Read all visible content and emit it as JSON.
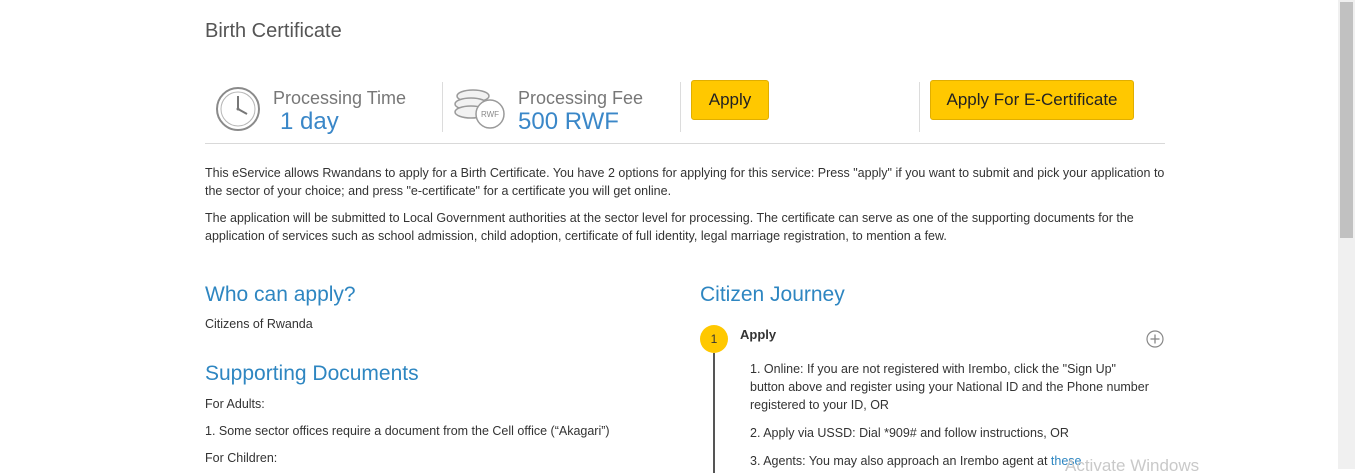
{
  "page": {
    "title": "Birth Certificate"
  },
  "info": {
    "processing_time_label": "Processing Time",
    "processing_time_value": "1 day",
    "processing_fee_label": "Processing Fee",
    "processing_fee_value": "500 RWF",
    "coin_text": "RWF",
    "apply_label": "Apply",
    "ecert_label": "Apply For E-Certificate"
  },
  "description": {
    "para1": "This eService allows Rwandans to apply for a Birth Certificate. You have 2 options for applying for this service: Press \"apply\" if you want to submit and pick your application to the sector of your choice; and press \"e-certificate\" for a certificate you will get online.",
    "para2": " The application will be submitted to Local Government authorities at the sector level for processing. The certificate can serve as one of the supporting documents for the application of services such as school admission, child adoption, certificate of full identity, legal marriage registration, to mention a few."
  },
  "who": {
    "heading": "Who can apply?",
    "text": "Citizens of Rwanda"
  },
  "docs": {
    "heading": "Supporting Documents",
    "adults_label": "For Adults:",
    "adults_item": "1. Some sector offices require a document from the Cell office (“Akagari”)",
    "children_label": "For Children:"
  },
  "journey": {
    "heading": "Citizen Journey",
    "step_number": "1",
    "step_title": "Apply",
    "item1": "1. Online: If you are not registered with Irembo, click the \"Sign Up\" button above and register using your National ID and the Phone number registered to your ID, OR",
    "item2": "2. Apply via USSD: Dial *909# and follow instructions, OR",
    "item3": "3. Agents: You may also approach an Irembo agent at ",
    "item3_link": "these"
  },
  "watermark": "Activate Windows"
}
